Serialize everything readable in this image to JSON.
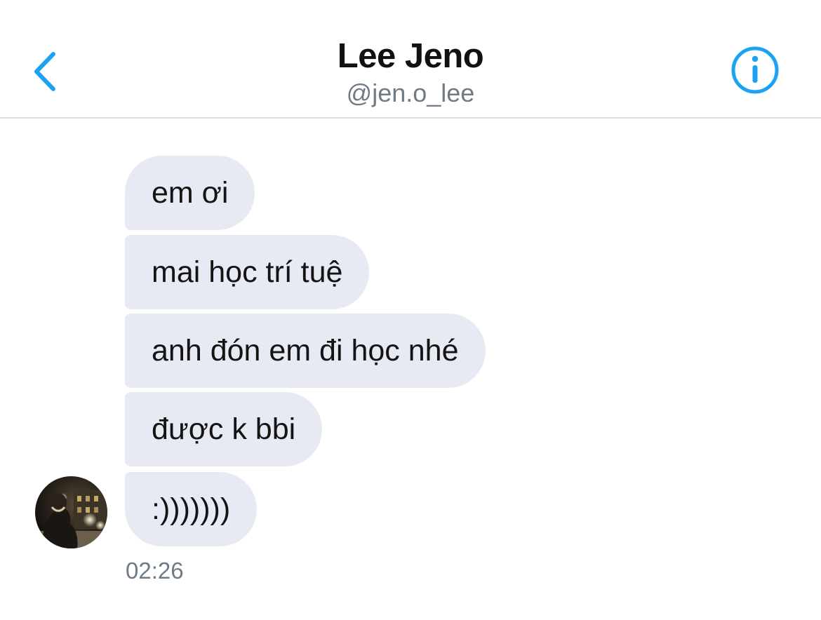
{
  "header": {
    "title": "Lee Jeno",
    "handle": "@jen.o_lee",
    "back_icon": "chevron-left-icon",
    "info_icon": "info-circle-icon",
    "accent_color": "#1da1f2"
  },
  "messages": [
    {
      "text": "em ơi"
    },
    {
      "text": "mai học trí tuệ"
    },
    {
      "text": "anh đón em đi học nhé"
    },
    {
      "text": "được k bbi"
    },
    {
      "text": ":)))))))"
    }
  ],
  "timestamp": "02:26",
  "colors": {
    "bubble": "#e7eaf2",
    "secondary_text": "#6e7b87",
    "divider": "#d9dde2"
  }
}
